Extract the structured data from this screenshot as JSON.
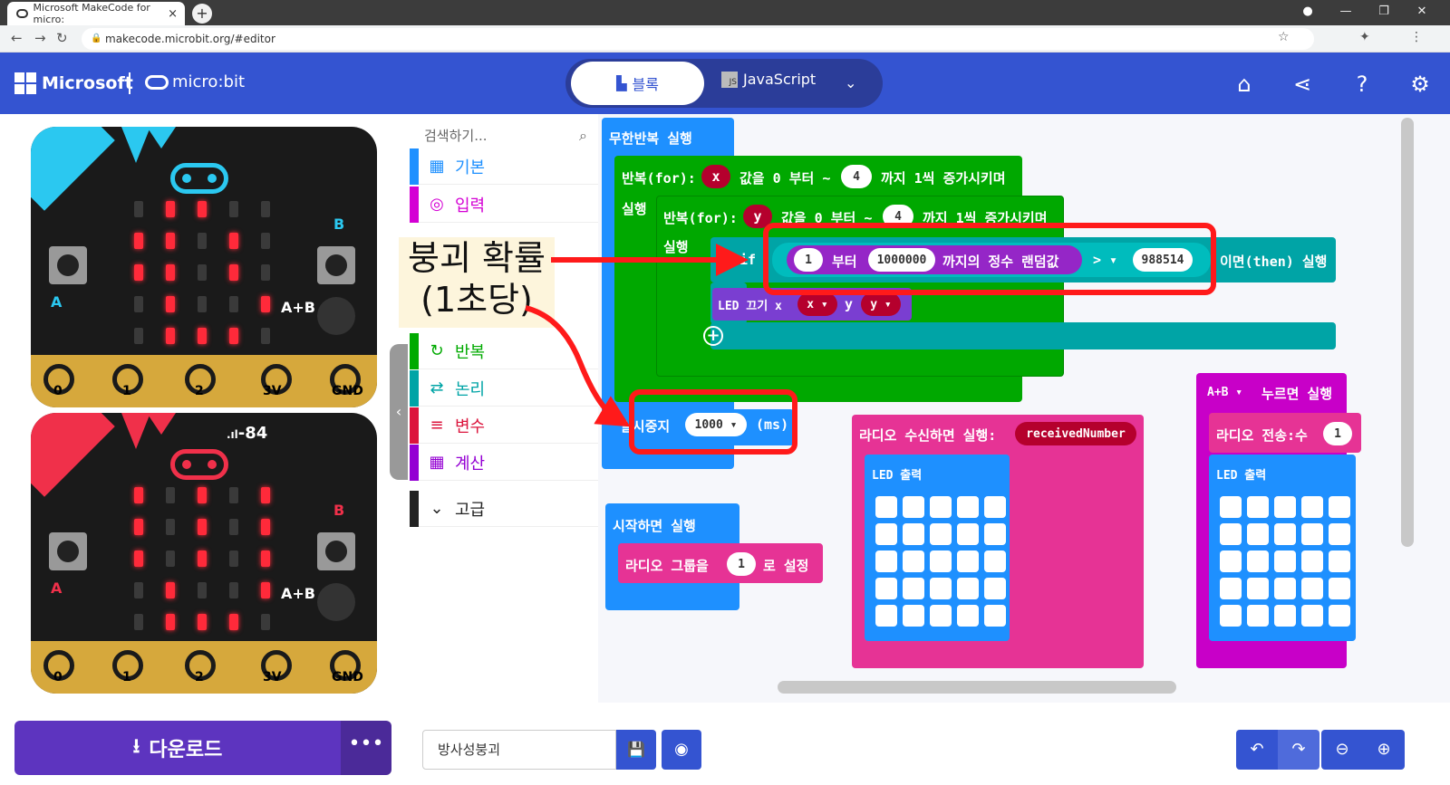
{
  "browser": {
    "tab_title": "Microsoft MakeCode for micro:",
    "tab_close": "×",
    "new_tab": "+",
    "url": "makecode.microbit.org/#editor"
  },
  "header": {
    "ms_brand": "Microsoft",
    "mb_brand": "micro:bit",
    "tab_blocks": "블록",
    "tab_js": "JavaScript",
    "js_badge": "JS"
  },
  "simulator": {
    "pins": [
      "0",
      "1",
      "2",
      "3V",
      "GND"
    ],
    "btn_a": "A",
    "btn_b": "B",
    "btn_ab": "A+B",
    "signal": "-84",
    "board1_leds": [
      [
        0,
        1,
        1,
        0,
        0
      ],
      [
        1,
        1,
        0,
        1,
        0
      ],
      [
        1,
        1,
        0,
        1,
        0
      ],
      [
        0,
        1,
        0,
        0,
        1
      ],
      [
        0,
        1,
        1,
        1,
        0
      ]
    ],
    "board2_leds": [
      [
        1,
        0,
        1,
        0,
        1
      ],
      [
        1,
        0,
        1,
        0,
        1
      ],
      [
        1,
        0,
        1,
        0,
        1
      ],
      [
        0,
        1,
        0,
        0,
        1
      ],
      [
        0,
        1,
        1,
        1,
        0
      ]
    ]
  },
  "toolbox": {
    "search_placeholder": "검색하기...",
    "categories": [
      {
        "label": "기본",
        "color": "#1e90ff",
        "icon": "grid-icon"
      },
      {
        "label": "입력",
        "color": "#d400d4",
        "icon": "target-icon"
      },
      {
        "label": "반복",
        "color": "#00aa00",
        "icon": "loop-icon"
      },
      {
        "label": "논리",
        "color": "#00a4a6",
        "icon": "shuffle-icon"
      },
      {
        "label": "변수",
        "color": "#dc143c",
        "icon": "list-icon"
      },
      {
        "label": "계산",
        "color": "#9400d3",
        "icon": "calculator-icon"
      },
      {
        "label": "고급",
        "color": "#222222",
        "icon": "chevron-down-icon"
      }
    ]
  },
  "blocks": {
    "forever": "무한반복 실행",
    "for1_a": "반복(for):",
    "for1_var": "x",
    "for1_b": "값을 0 부터 ~",
    "for1_n": "4",
    "for1_c": "까지 1씩 증가시키며",
    "do1": "실행",
    "for2_a": "반복(for):",
    "for2_var": "y",
    "for2_b": "값을 0 부터 ~",
    "for2_n": "4",
    "for2_c": "까지 1씩 증가시키며",
    "do2": "실행",
    "if_kw": "if",
    "rand_from": "1",
    "rand_a": "부터",
    "rand_to": "1000000",
    "rand_b": "까지의 정수 랜덤값",
    "op": "> ▾",
    "cmp": "988514",
    "then": "이면(then) 실행",
    "led_off": "LED 끄기 x",
    "led_x": "x ▾",
    "led_y_lbl": "y",
    "led_y": "y ▾",
    "pause_a": "일시중지",
    "pause_v": "1000 ▾",
    "pause_b": "(ms)",
    "start": "시작하면 실행",
    "radio_group": "라디오 그룹을",
    "radio_group_v": "1",
    "radio_group_b": "로 설정",
    "radio_recv": "라디오 수신하면 실행:",
    "radio_recv_v": "receivedNumber",
    "led_show1": "LED 출력",
    "ab_btn": "A+B ▾",
    "ab_txt": "누르면 실행",
    "radio_send": "라디오 전송:수",
    "radio_send_v": "1",
    "led_show2": "LED 출력"
  },
  "annotation": {
    "line1": "붕괴 확률",
    "line2": "(1초당)"
  },
  "bottom": {
    "download": "다운로드",
    "more": "•••",
    "project_name": "방사성붕괴"
  }
}
